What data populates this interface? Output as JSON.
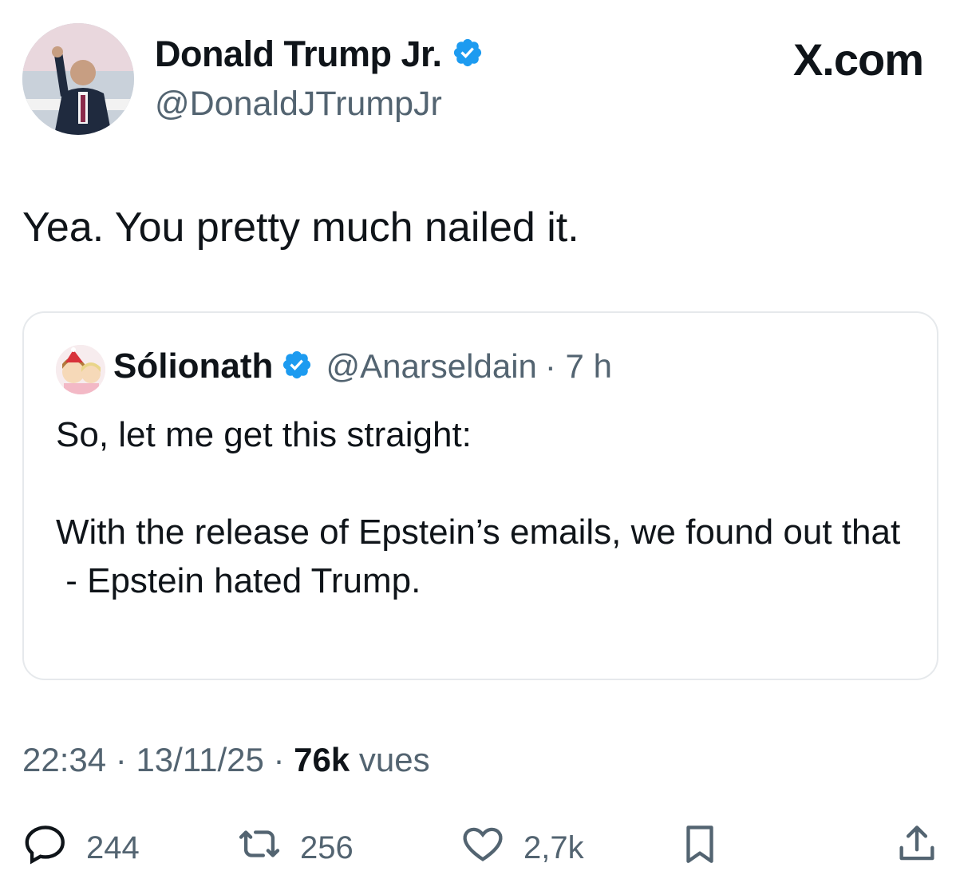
{
  "author": {
    "name": "Donald Trump Jr.",
    "handle": "@DonaldJTrumpJr",
    "verified": true,
    "avatar_desc": "photo-avatar"
  },
  "brand": {
    "label": "X.com"
  },
  "tweet": {
    "text": "Yea. You pretty much nailed it."
  },
  "quoted": {
    "name": "Sólionath",
    "handle": "@Anarseldain",
    "time": "· 7 h",
    "verified": true,
    "text": "So, let me get this straight:\n\nWith the release of Epstein’s emails, we found out that\n - Epstein hated Trump."
  },
  "meta": {
    "time": "22:34",
    "date": "13/11/25",
    "views_count": "76k",
    "views_label": "vues",
    "sep": "·"
  },
  "actions": {
    "replies": "244",
    "reposts": "256",
    "likes": "2,7k"
  },
  "colors": {
    "verified_blue": "#1d9bf0",
    "secondary_text": "#536471",
    "primary_text": "#0f1419",
    "border": "#e6e9ec"
  }
}
